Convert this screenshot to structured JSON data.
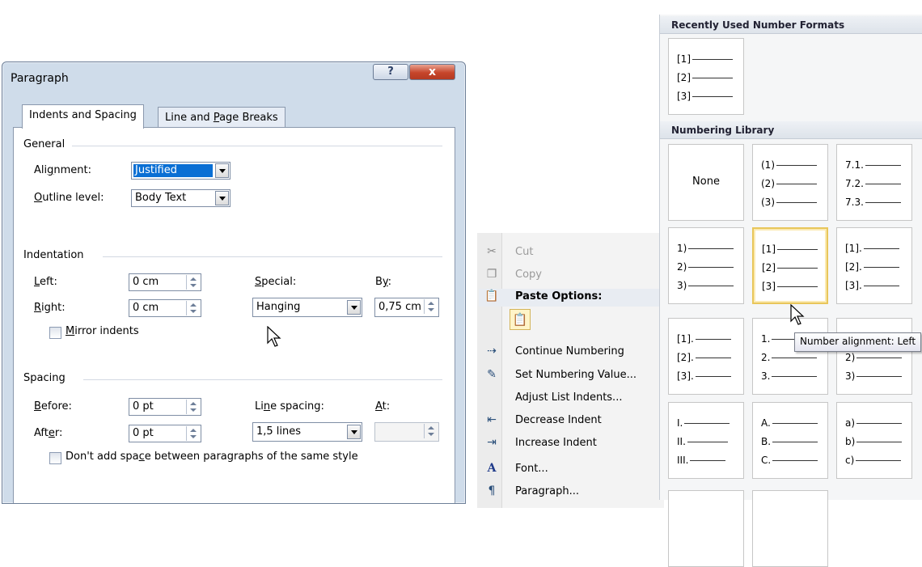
{
  "dialog": {
    "title": "Paragraph",
    "help_icon": "?",
    "close_icon": "x",
    "tabs": [
      "Indents and Spacing",
      "Line and Page Breaks"
    ],
    "general": {
      "heading": "General",
      "alignment_label": "Alignment:",
      "alignment_value": "Justified",
      "outline_label": "Outline level:",
      "outline_value": "Body Text"
    },
    "indentation": {
      "heading": "Indentation",
      "left_label": "Left:",
      "left_value": "0 cm",
      "right_label": "Right:",
      "right_value": "0 cm",
      "special_label": "Special:",
      "special_value": "Hanging",
      "by_label": "By:",
      "by_value": "0,75 cm",
      "mirror_label": "Mirror indents"
    },
    "spacing": {
      "heading": "Spacing",
      "before_label": "Before:",
      "before_value": "0 pt",
      "after_label": "After:",
      "after_value": "0 pt",
      "line_spacing_label": "Line spacing:",
      "line_spacing_value": "1,5 lines",
      "at_label": "At:",
      "at_value": "",
      "dont_add_label": "Don't add space between paragraphs of the same style"
    }
  },
  "context_menu": {
    "items": [
      {
        "icon": "scissors-icon",
        "label": "Cut",
        "disabled": true
      },
      {
        "icon": "copy-icon",
        "label": "Copy",
        "disabled": true
      },
      {
        "icon": "paste-icon",
        "label": "Paste Options:",
        "bold": true
      },
      {
        "icon": "continue-numbering-icon",
        "label": "Continue Numbering"
      },
      {
        "icon": "set-numbering-value-icon",
        "label": "Set Numbering Value..."
      },
      {
        "icon": "",
        "label": "Adjust List Indents..."
      },
      {
        "icon": "decrease-indent-icon",
        "label": "Decrease Indent"
      },
      {
        "icon": "increase-indent-icon",
        "label": "Increase Indent"
      },
      {
        "icon": "font-icon",
        "label": "Font..."
      },
      {
        "icon": "paragraph-icon",
        "label": "Paragraph..."
      }
    ]
  },
  "numbering_gallery": {
    "recent_heading": "Recently Used Number Formats",
    "library_heading": "Numbering Library",
    "recent": [
      [
        "[1]",
        "[2]",
        "[3]"
      ]
    ],
    "library": [
      [
        "None"
      ],
      [
        "(1)",
        "(2)",
        "(3)"
      ],
      [
        "7.1.",
        "7.2.",
        "7.3."
      ],
      [
        "1)",
        "2)",
        "3)"
      ],
      [
        "[1]",
        "[2]",
        "[3]"
      ],
      [
        "[1].",
        "[2].",
        "[3]."
      ],
      [
        "[1].",
        "[2].",
        "[3]."
      ],
      [
        "1.",
        "2.",
        "3."
      ],
      [
        "1)",
        "2)",
        "3)"
      ],
      [
        "I.",
        "II.",
        "III."
      ],
      [
        "A.",
        "B.",
        "C."
      ],
      [
        "a)",
        "b)",
        "c)"
      ]
    ],
    "tooltip": "Number alignment: Left"
  },
  "colors": {
    "dialog_bg": "#cfdcea",
    "close_button": "#c6452b",
    "selected_highlight": "#0a6fd4",
    "gallery_selection": "#e8c65a"
  }
}
